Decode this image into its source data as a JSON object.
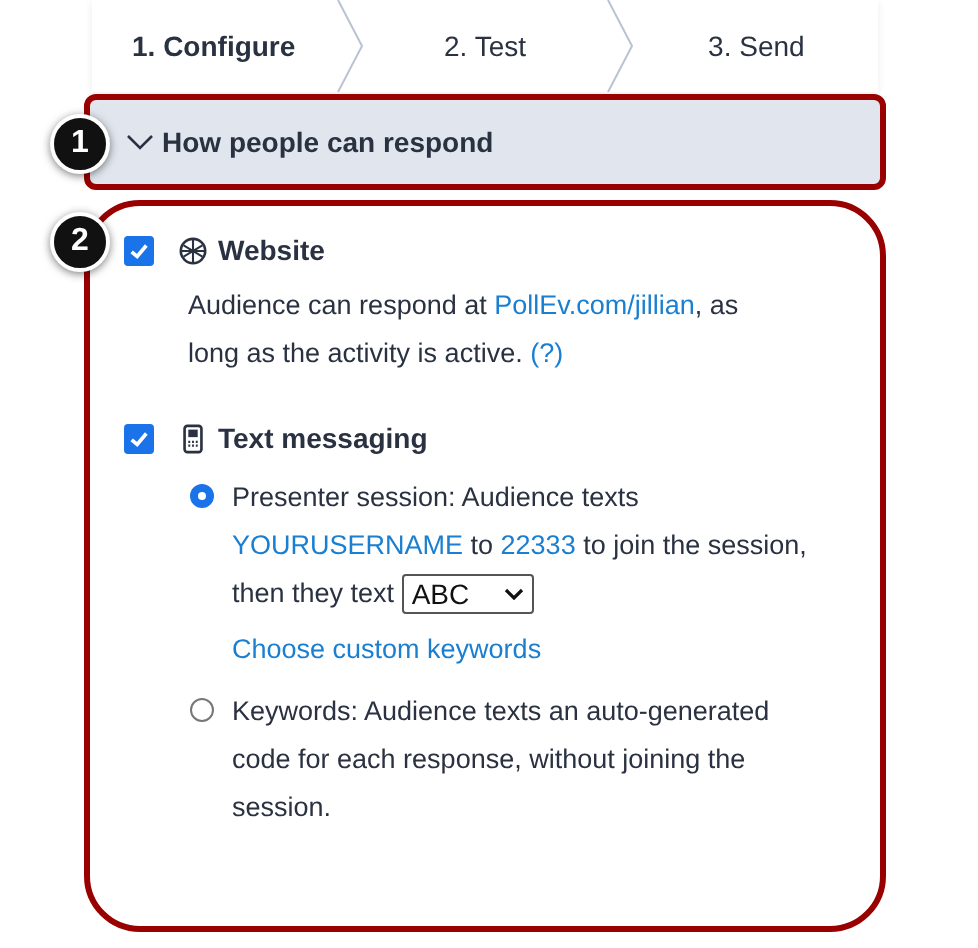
{
  "steps": [
    {
      "label": "1. Configure",
      "selected": true
    },
    {
      "label": "2. Test",
      "selected": false
    },
    {
      "label": "3. Send",
      "selected": false
    }
  ],
  "section": {
    "callout": "1",
    "title": "How people can respond",
    "expanded": true
  },
  "options_callout": "2",
  "options": [
    {
      "kind": "website",
      "title": "Website",
      "checked": true,
      "description": [
        {
          "kind": "text",
          "text": "Audience can respond at "
        },
        {
          "kind": "link",
          "text": "PollEv.com/jillian"
        },
        {
          "kind": "text",
          "text": ", as long as the activity is active. "
        },
        {
          "kind": "link",
          "text": "(?)"
        }
      ]
    },
    {
      "kind": "sms",
      "title": "Text messaging",
      "checked": true,
      "modes": [
        {
          "selected": true,
          "segments": [
            {
              "kind": "text",
              "text": "Presenter session: Audience texts "
            },
            {
              "kind": "link",
              "text": "YOURUSERNAME"
            },
            {
              "kind": "text",
              "text": " to "
            },
            {
              "kind": "link",
              "text": "22333"
            },
            {
              "kind": "text",
              "text": " to join the session, then they text "
            },
            {
              "kind": "select",
              "text": "ABC"
            }
          ],
          "action": "Choose custom keywords"
        },
        {
          "selected": false,
          "segments": [
            {
              "kind": "text",
              "text": "Keywords: Audience texts an auto-generated code for each response, without joining the session."
            }
          ]
        }
      ]
    }
  ]
}
